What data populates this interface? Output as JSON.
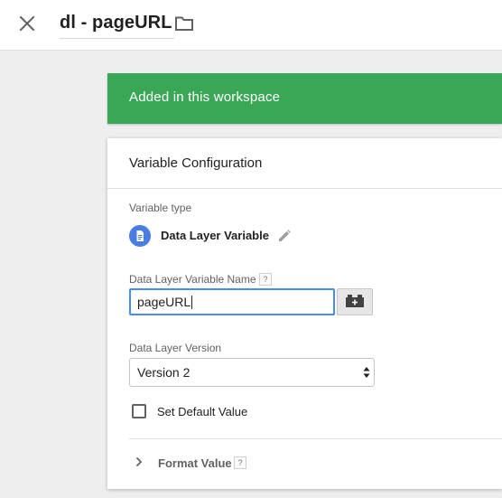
{
  "header": {
    "title": "dl - pageURL"
  },
  "banner": {
    "text": "Added in this workspace",
    "color": "#3aa757"
  },
  "card": {
    "title": "Variable Configuration",
    "variable_type_label": "Variable type",
    "variable_type_name": "Data Layer Variable",
    "variable_name_label": "Data Layer Variable Name",
    "variable_name_value": "pageURL",
    "help_mark": "?",
    "version_label": "Data Layer Version",
    "version_value": "Version 2",
    "default_value_label": "Set Default Value",
    "format_value_label": "Format Value"
  },
  "colors": {
    "accent": "#4a8af4",
    "type_icon_bg": "#4a7de2"
  },
  "icons": {
    "close": "close-icon",
    "folder": "folder-icon",
    "type": "document-icon",
    "edit": "pencil-icon",
    "variable_picker": "lego-brick-plus-icon",
    "select": "up-down-arrows-icon",
    "expand": "chevron-right-icon"
  }
}
